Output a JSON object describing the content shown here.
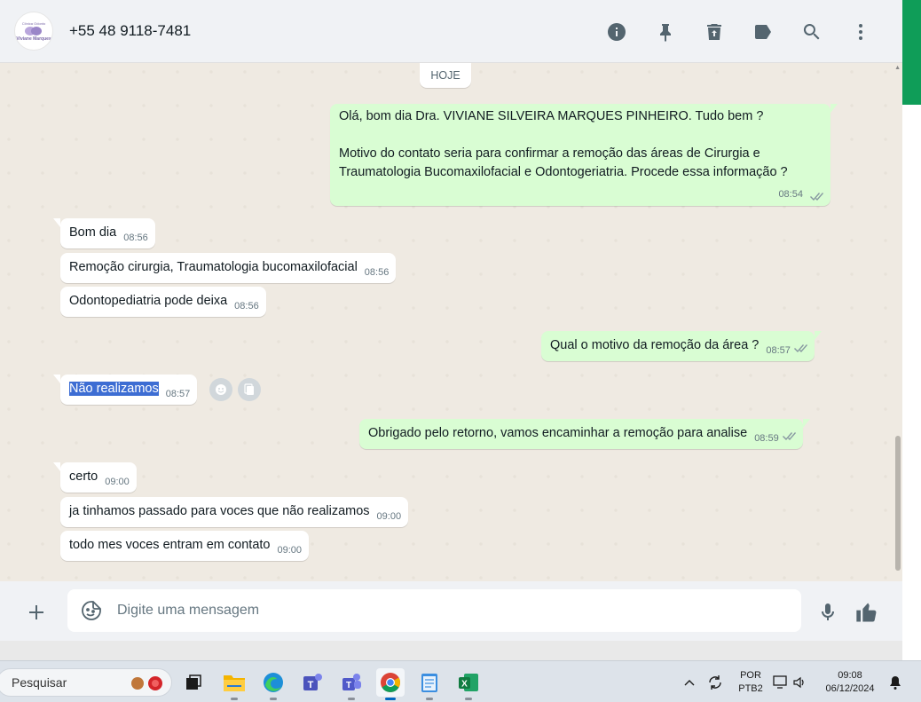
{
  "header": {
    "contact_name": "+55 48 9118-7481",
    "avatar_logo_top": "Clínica Odonto",
    "avatar_logo_mid": "Viviane Marques",
    "icons": [
      "info-icon",
      "pin-icon",
      "delete-icon",
      "label-icon",
      "search-icon",
      "more-options-icon"
    ]
  },
  "chat": {
    "day_label": "HOJE",
    "messages": [
      {
        "dir": "out",
        "lines": [
          "Olá, bom dia Dra.  VIVIANE SILVEIRA MARQUES PINHEIRO. Tudo bem ?",
          "",
          "Motivo do contato seria para confirmar a remoção das áreas de  Cirurgia e",
          "Traumatologia Bucomaxilofacial e Odontogeriatria. Procede essa informação ?"
        ],
        "time": "08:54",
        "status": "read"
      },
      {
        "dir": "in",
        "text": "Bom dia",
        "time": "08:56"
      },
      {
        "dir": "in",
        "text": "Remoção cirurgia, Traumatologia bucomaxilofacial",
        "time": "08:56"
      },
      {
        "dir": "in",
        "text": "Odontopediatria pode deixa",
        "time": "08:56"
      },
      {
        "dir": "out",
        "text": "Qual o motivo da remoção da área ?",
        "time": "08:57",
        "status": "read"
      },
      {
        "dir": "in",
        "text": "Não realizamos",
        "time": "08:57",
        "selected": true
      },
      {
        "dir": "out",
        "text": "Obrigado pelo retorno, vamos encaminhar a remoção para analise",
        "time": "08:59",
        "status": "read"
      },
      {
        "dir": "in",
        "text": "certo",
        "time": "09:00"
      },
      {
        "dir": "in",
        "text": "ja tinhamos passado para voces que não realizamos",
        "time": "09:00"
      },
      {
        "dir": "in",
        "text": "todo mes voces entram em contato",
        "time": "09:00"
      }
    ]
  },
  "composer": {
    "placeholder": "Digite uma mensagem"
  },
  "taskbar": {
    "search_label": "Pesquisar",
    "apps": [
      "task-view",
      "file-explorer",
      "edge",
      "teams-classic",
      "teams",
      "chrome",
      "notepad",
      "excel"
    ],
    "active_app": "chrome",
    "lang_top": "POR",
    "lang_bottom": "PTB2",
    "time": "09:08",
    "date": "06/12/2024"
  },
  "colors": {
    "chat_bg": "#efeae2",
    "incoming": "#ffffff",
    "outgoing": "#d9fdd3",
    "icon_gray": "#54656f",
    "selection": "#3d6dd3",
    "accent_green": "#0f9d58"
  }
}
